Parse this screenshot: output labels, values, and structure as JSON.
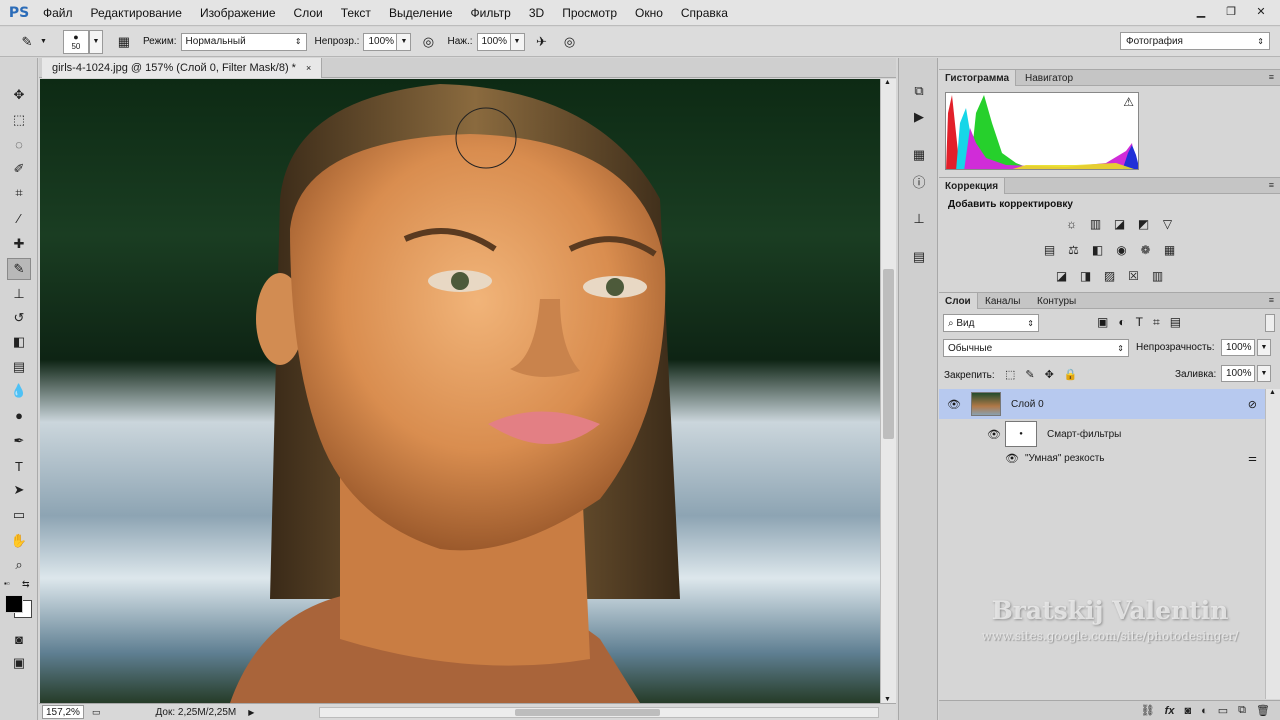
{
  "app": {
    "logo": "PS"
  },
  "menu": [
    "Файл",
    "Редактирование",
    "Изображение",
    "Слои",
    "Текст",
    "Выделение",
    "Фильтр",
    "3D",
    "Просмотр",
    "Окно",
    "Справка"
  ],
  "window_controls": {
    "minimize": "▁",
    "restore": "❐",
    "close": "✕"
  },
  "options": {
    "brush_size": "50",
    "mode_label": "Режим:",
    "mode_value": "Нормальный",
    "opacity_label": "Непрозр.:",
    "opacity_value": "100%",
    "flow_label": "Наж.:",
    "flow_value": "100%",
    "workspace": "Фотография"
  },
  "document": {
    "tab_title": "girls-4-1024.jpg @ 157% (Слой 0, Filter Mask/8) *",
    "close": "×"
  },
  "status": {
    "zoom": "157,2%",
    "doc": "Док: 2,25M/2,25M"
  },
  "panels": {
    "histogram_tab": "Гистограмма",
    "navigator_tab": "Навигатор",
    "histogram_warning": "⚠",
    "correction_tab": "Коррекция",
    "add_adjustment": "Добавить корректировку",
    "layers_tab": "Слои",
    "channels_tab": "Каналы",
    "paths_tab": "Контуры",
    "filter_kind": "Вид",
    "blend_mode": "Обычные",
    "opacity_label": "Непрозрачность:",
    "opacity_value": "100%",
    "lock_label": "Закрепить:",
    "fill_label": "Заливка:",
    "fill_value": "100%"
  },
  "layers": [
    {
      "name": "Слой 0"
    },
    {
      "name": "Смарт-фильтры"
    },
    {
      "name": "\"Умная\" резкость"
    }
  ],
  "watermark": {
    "name": "Bratskij Valentin",
    "url": "www.sites.google.com/site/photodesinger/"
  },
  "colors": {
    "accent": "#2b6cb8",
    "selected_layer": "#b7c9ef",
    "panel_bg": "#d6d6d6"
  }
}
